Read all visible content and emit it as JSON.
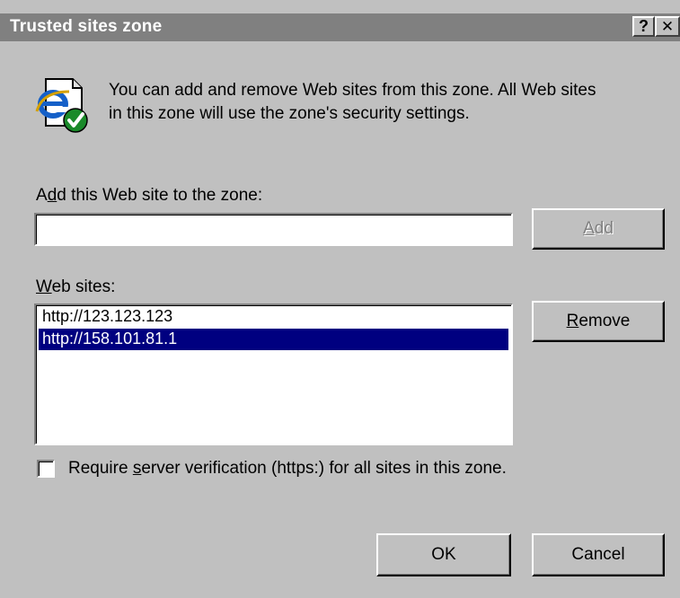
{
  "window": {
    "title": "Trusted sites zone",
    "help_button": "?",
    "close_button": "✕"
  },
  "info": {
    "icon": "ie-globe-checkmark-icon",
    "text_line1": "You can add and remove Web sites from this zone. All Web sites",
    "text_line2": "in this zone will use the zone's security settings."
  },
  "add_site": {
    "label_prefix": "A",
    "label_mnemonic": "d",
    "label_suffix": "d this Web site to the zone:",
    "input_value": "",
    "add_button": {
      "mnemonic": "A",
      "rest": "dd",
      "enabled": false
    }
  },
  "web_sites": {
    "label_mnemonic": "W",
    "label_suffix": "eb sites:",
    "items": [
      {
        "url": "http://123.123.123",
        "selected": false
      },
      {
        "url": "http://158.101.81.1",
        "selected": true
      }
    ],
    "remove_button": {
      "mnemonic": "R",
      "rest": "emove"
    }
  },
  "require_verification": {
    "checked": false,
    "label_prefix": "Require ",
    "label_mnemonic": "s",
    "label_suffix": "erver verification (https:) for all sites in this zone."
  },
  "buttons": {
    "ok": "OK",
    "cancel": "Cancel"
  },
  "colors": {
    "face": "#c0c0c0",
    "titlebar_inactive": "#808080",
    "selection": "#000080",
    "ie_blue": "#1560c8",
    "check_green": "#1a8a2a"
  }
}
